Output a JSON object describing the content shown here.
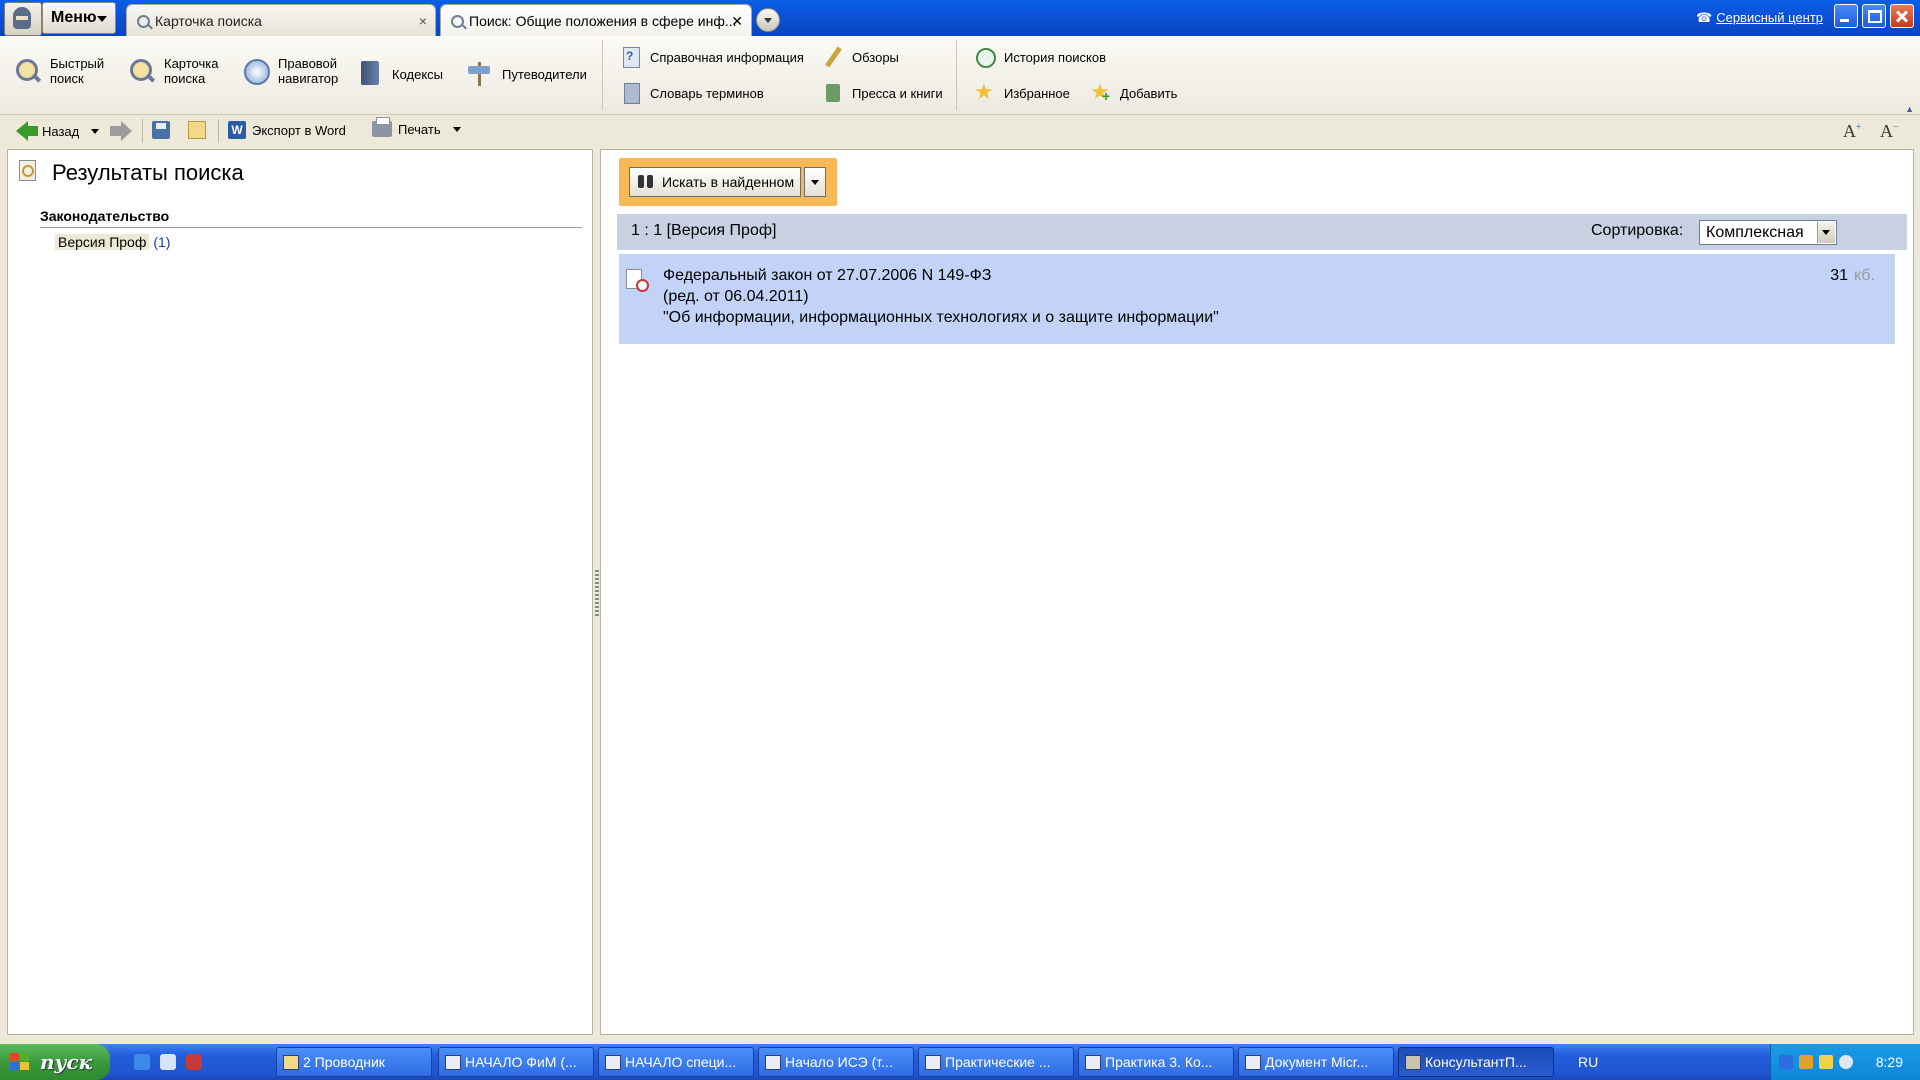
{
  "tabs": [
    {
      "label": "Карточка поиска"
    },
    {
      "label": "Поиск: Общие положения в сфере инф..."
    }
  ],
  "header": {
    "menu_label": "Меню",
    "service_label": "Сервисный центр"
  },
  "ribbon": {
    "quick_search": {
      "line1": "Быстрый",
      "line2": "поиск"
    },
    "search_card": {
      "line1": "Карточка",
      "line2": "поиска"
    },
    "legal_navigator": {
      "line1": "Правовой",
      "line2": "навигатор"
    },
    "codes": "Кодексы",
    "guides": "Путеводители",
    "reference_info": "Справочная информация",
    "glossary": "Словарь терминов",
    "reviews": "Обзоры",
    "press_books": "Пресса и книги",
    "search_history": "История поисков",
    "favorites": "Избранное",
    "add": "Добавить"
  },
  "toolbar": {
    "back_label": "Назад",
    "export_word": "Экспорт в Word",
    "print": "Печать"
  },
  "left_panel": {
    "title": "Результаты поиска",
    "section": "Законодательство",
    "items": [
      {
        "name": "Версия Проф",
        "count": "(1)"
      }
    ]
  },
  "right_panel": {
    "search_in_found": "Искать в найденном",
    "result_count": "1 : 1 [Версия Проф]",
    "sort_label": "Сортировка:",
    "sort_value": "Комплексная",
    "documents": [
      {
        "line1": "Федеральный закон от 27.07.2006 N 149-ФЗ",
        "line2": "(ред. от 06.04.2011)",
        "line3": "\"Об информации, информационных технологиях и о защите информации\"",
        "size": "31",
        "size_unit": "кб."
      }
    ]
  },
  "taskbar": {
    "start_label": "пуск",
    "tasks": [
      {
        "label": "2 Проводник"
      },
      {
        "label": "НАЧАЛО ФиМ (..."
      },
      {
        "label": "НАЧАЛО специ..."
      },
      {
        "label": "Начало ИСЭ (т..."
      },
      {
        "label": "Практические ..."
      },
      {
        "label": "Практика 3. Ко..."
      },
      {
        "label": "Документ Micr..."
      },
      {
        "label": "КонсультантП..."
      }
    ],
    "language": "RU",
    "clock": "8:29"
  }
}
